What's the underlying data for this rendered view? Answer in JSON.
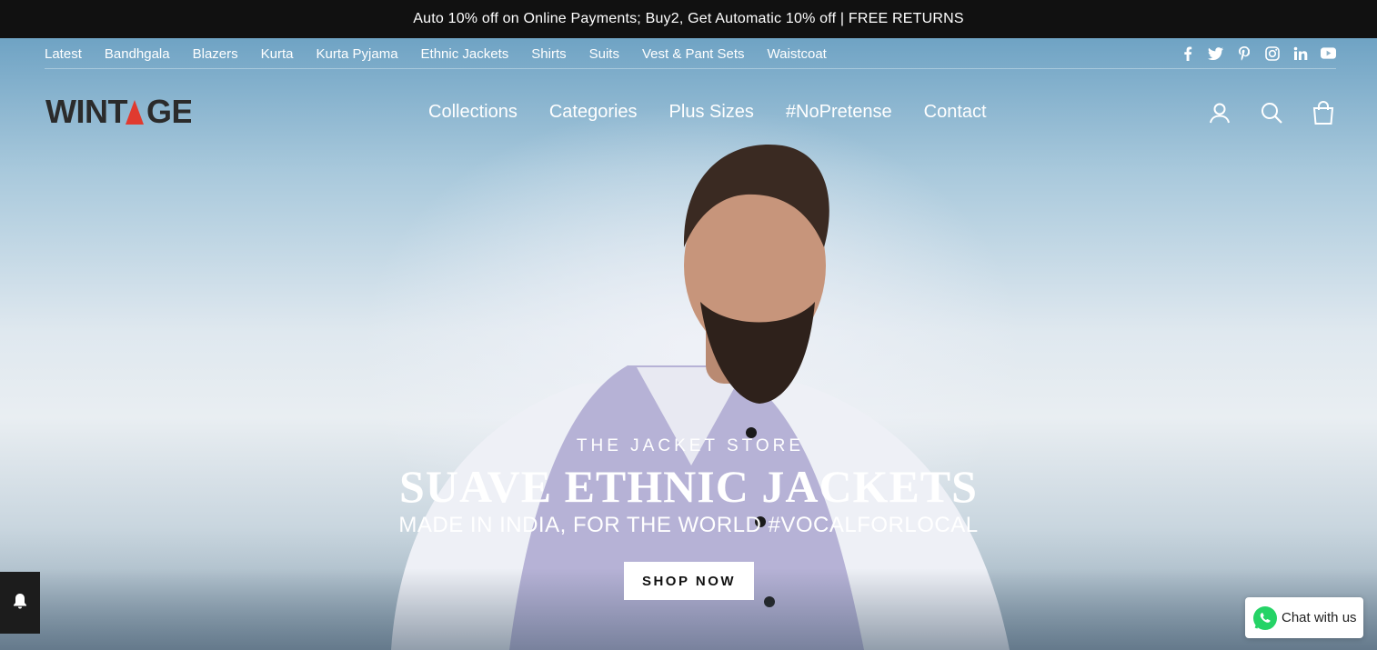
{
  "announcement": {
    "text": "Auto 10% off on Online Payments; Buy2, Get Automatic 10% off | FREE RETURNS"
  },
  "subnav": {
    "items": [
      "Latest",
      "Bandhgala",
      "Blazers",
      "Kurta",
      "Kurta Pyjama",
      "Ethnic Jackets",
      "Shirts",
      "Suits",
      "Vest & Pant Sets",
      "Waistcoat"
    ]
  },
  "social": [
    "facebook-icon",
    "twitter-icon",
    "pinterest-icon",
    "instagram-icon",
    "linkedin-icon",
    "youtube-icon"
  ],
  "logo": {
    "text": "WINTAGE",
    "accent": "#e03a2f"
  },
  "mainnav": {
    "items": [
      "Collections",
      "Categories",
      "Plus Sizes",
      "#NoPretense",
      "Contact"
    ]
  },
  "header_icons": [
    "account-icon",
    "search-icon",
    "cart-icon"
  ],
  "hero": {
    "eyebrow": "THE JACKET STORE",
    "headline": "SUAVE ETHNIC JACKETS",
    "subline": "MADE IN INDIA, FOR THE WORLD #VOCALFORLOCAL",
    "button": "SHOP NOW"
  },
  "chat": {
    "label": "Chat with us",
    "accent": "#25d366"
  },
  "colors": {
    "announce_bg": "#111111",
    "text": "#ffffff"
  }
}
